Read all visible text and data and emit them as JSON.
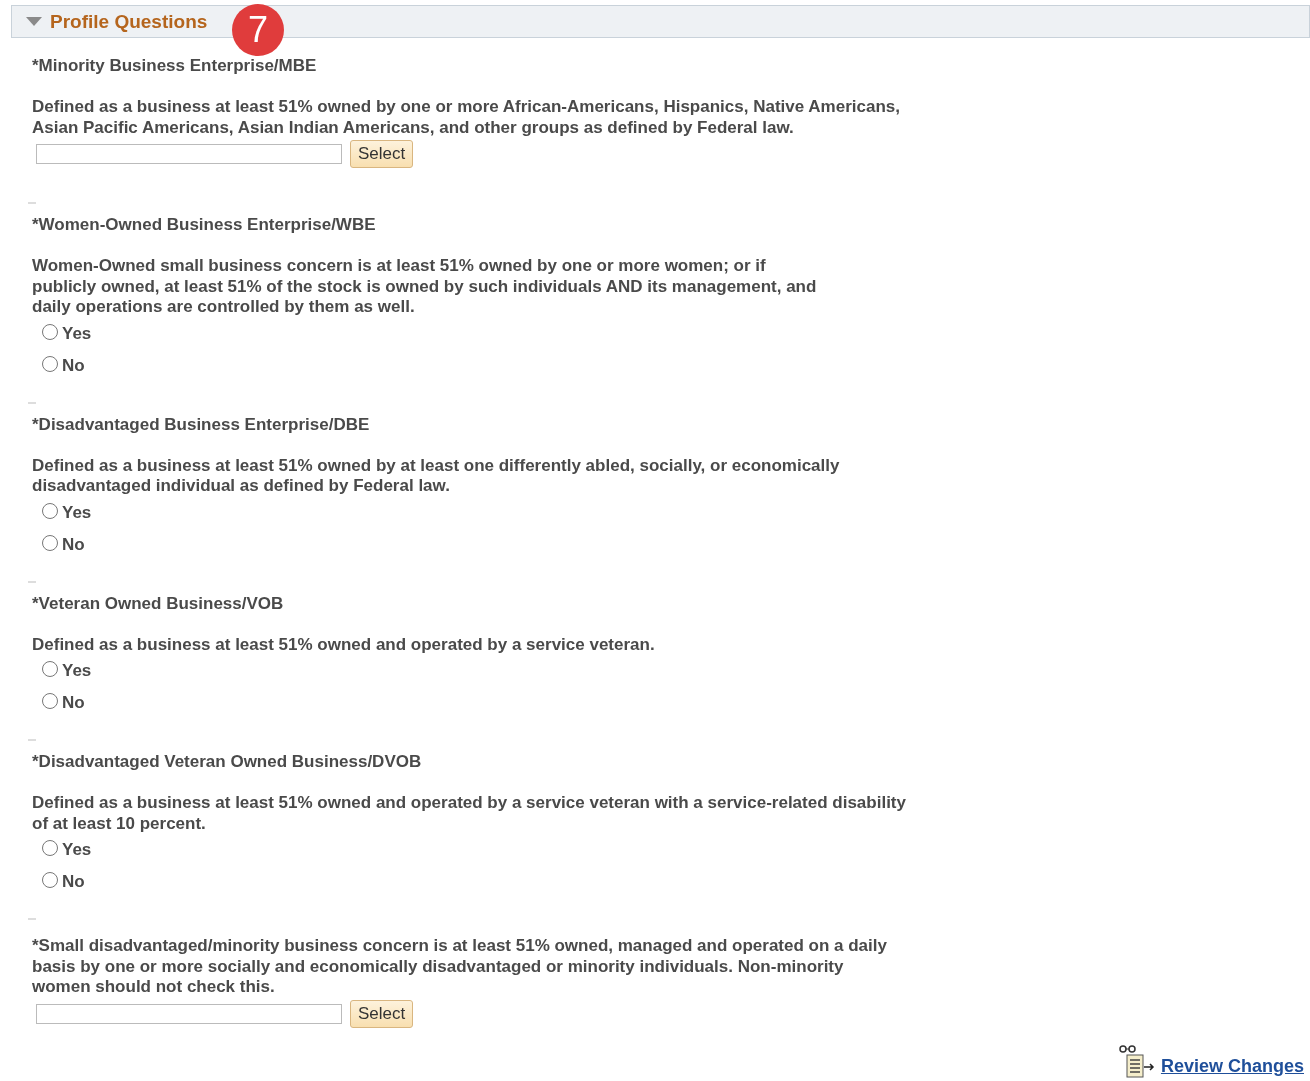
{
  "section": {
    "title": "Profile Questions",
    "expanded": true,
    "badge": "7"
  },
  "questions": [
    {
      "kind": "select",
      "title": "*Minority Business Enterprise/MBE",
      "description": "Defined as a business at least 51% owned by one or more African-Americans, Hispanics, Native Americans,\nAsian Pacific Americans, Asian Indian Americans, and other groups as defined by Federal law.",
      "button": "Select"
    },
    {
      "kind": "radio",
      "title": "*Women-Owned Business Enterprise/WBE",
      "description": "Women-Owned small business concern is at least 51% owned by one or more women; or if\npublicly owned, at least 51% of the stock is owned by such individuals AND its management, and\ndaily operations are controlled by them as well.",
      "options": [
        {
          "label": "Yes",
          "selected": false
        },
        {
          "label": "No",
          "selected": false
        }
      ]
    },
    {
      "kind": "radio",
      "title": "*Disadvantaged Business Enterprise/DBE",
      "description": "Defined as a business at least 51% owned by at least one differently abled, socially, or economically\ndisadvantaged individual as defined by Federal law.",
      "options": [
        {
          "label": "Yes",
          "selected": false
        },
        {
          "label": "No",
          "selected": false
        }
      ]
    },
    {
      "kind": "radio",
      "title": "*Veteran Owned Business/VOB",
      "description": "Defined as a business at least 51% owned and operated by a service veteran.",
      "options": [
        {
          "label": "Yes",
          "selected": false
        },
        {
          "label": "No",
          "selected": false
        }
      ]
    },
    {
      "kind": "radio",
      "title": "*Disadvantaged Veteran Owned Business/DVOB",
      "description": "Defined as a business at least 51% owned and operated by a service veteran with a service-related disability\nof at least 10 percent.",
      "options": [
        {
          "label": "Yes",
          "selected": false
        },
        {
          "label": "No",
          "selected": false
        }
      ]
    },
    {
      "kind": "select",
      "description": "*Small disadvantaged/minority business concern is at least 51% owned, managed and operated on a daily\nbasis by one or more socially and economically disadvantaged or minority individuals. Non-minority\nwomen should not check this.",
      "button": "Select"
    }
  ],
  "review_link": "Review Changes"
}
